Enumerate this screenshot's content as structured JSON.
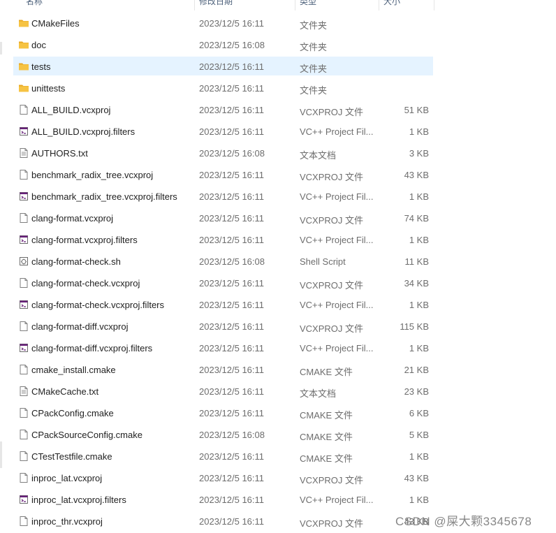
{
  "columns": {
    "name": "名称",
    "date": "修改日期",
    "type": "类型",
    "size": "大小"
  },
  "files": [
    {
      "name": "CMakeFiles",
      "date": "2023/12/5 16:11",
      "type": "文件夹",
      "size": "",
      "icon": "folder-icon"
    },
    {
      "name": "doc",
      "date": "2023/12/5 16:08",
      "type": "文件夹",
      "size": "",
      "icon": "folder-icon"
    },
    {
      "name": "tests",
      "date": "2023/12/5 16:11",
      "type": "文件夹",
      "size": "",
      "icon": "folder-icon",
      "selected": true
    },
    {
      "name": "unittests",
      "date": "2023/12/5 16:11",
      "type": "文件夹",
      "size": "",
      "icon": "folder-icon"
    },
    {
      "name": "ALL_BUILD.vcxproj",
      "date": "2023/12/5 16:11",
      "type": "VCXPROJ 文件",
      "size": "51 KB",
      "icon": "file-icon"
    },
    {
      "name": "ALL_BUILD.vcxproj.filters",
      "date": "2023/12/5 16:11",
      "type": "VC++ Project Fil...",
      "size": "1 KB",
      "icon": "filters-file-icon"
    },
    {
      "name": "AUTHORS.txt",
      "date": "2023/12/5 16:08",
      "type": "文本文档",
      "size": "3 KB",
      "icon": "text-file-icon"
    },
    {
      "name": "benchmark_radix_tree.vcxproj",
      "date": "2023/12/5 16:11",
      "type": "VCXPROJ 文件",
      "size": "43 KB",
      "icon": "file-icon"
    },
    {
      "name": "benchmark_radix_tree.vcxproj.filters",
      "date": "2023/12/5 16:11",
      "type": "VC++ Project Fil...",
      "size": "1 KB",
      "icon": "filters-file-icon"
    },
    {
      "name": "clang-format.vcxproj",
      "date": "2023/12/5 16:11",
      "type": "VCXPROJ 文件",
      "size": "74 KB",
      "icon": "file-icon"
    },
    {
      "name": "clang-format.vcxproj.filters",
      "date": "2023/12/5 16:11",
      "type": "VC++ Project Fil...",
      "size": "1 KB",
      "icon": "filters-file-icon"
    },
    {
      "name": "clang-format-check.sh",
      "date": "2023/12/5 16:08",
      "type": "Shell Script",
      "size": "11 KB",
      "icon": "shell-script-icon"
    },
    {
      "name": "clang-format-check.vcxproj",
      "date": "2023/12/5 16:11",
      "type": "VCXPROJ 文件",
      "size": "34 KB",
      "icon": "file-icon"
    },
    {
      "name": "clang-format-check.vcxproj.filters",
      "date": "2023/12/5 16:11",
      "type": "VC++ Project Fil...",
      "size": "1 KB",
      "icon": "filters-file-icon"
    },
    {
      "name": "clang-format-diff.vcxproj",
      "date": "2023/12/5 16:11",
      "type": "VCXPROJ 文件",
      "size": "115 KB",
      "icon": "file-icon"
    },
    {
      "name": "clang-format-diff.vcxproj.filters",
      "date": "2023/12/5 16:11",
      "type": "VC++ Project Fil...",
      "size": "1 KB",
      "icon": "filters-file-icon"
    },
    {
      "name": "cmake_install.cmake",
      "date": "2023/12/5 16:11",
      "type": "CMAKE 文件",
      "size": "21 KB",
      "icon": "file-icon"
    },
    {
      "name": "CMakeCache.txt",
      "date": "2023/12/5 16:11",
      "type": "文本文档",
      "size": "23 KB",
      "icon": "text-file-icon"
    },
    {
      "name": "CPackConfig.cmake",
      "date": "2023/12/5 16:11",
      "type": "CMAKE 文件",
      "size": "6 KB",
      "icon": "file-icon"
    },
    {
      "name": "CPackSourceConfig.cmake",
      "date": "2023/12/5 16:08",
      "type": "CMAKE 文件",
      "size": "5 KB",
      "icon": "file-icon"
    },
    {
      "name": "CTestTestfile.cmake",
      "date": "2023/12/5 16:11",
      "type": "CMAKE 文件",
      "size": "1 KB",
      "icon": "file-icon"
    },
    {
      "name": "inproc_lat.vcxproj",
      "date": "2023/12/5 16:11",
      "type": "VCXPROJ 文件",
      "size": "43 KB",
      "icon": "file-icon"
    },
    {
      "name": "inproc_lat.vcxproj.filters",
      "date": "2023/12/5 16:11",
      "type": "VC++ Project Fil...",
      "size": "1 KB",
      "icon": "filters-file-icon"
    },
    {
      "name": "inproc_thr.vcxproj",
      "date": "2023/12/5 16:11",
      "type": "VCXPROJ 文件",
      "size": "43 KB",
      "icon": "file-icon"
    }
  ],
  "watermark": "CSDN @屎大颗3345678",
  "colors": {
    "selected_row": "#e5f3ff",
    "folder": "#f6c343",
    "filters_accent": "#68217a"
  }
}
